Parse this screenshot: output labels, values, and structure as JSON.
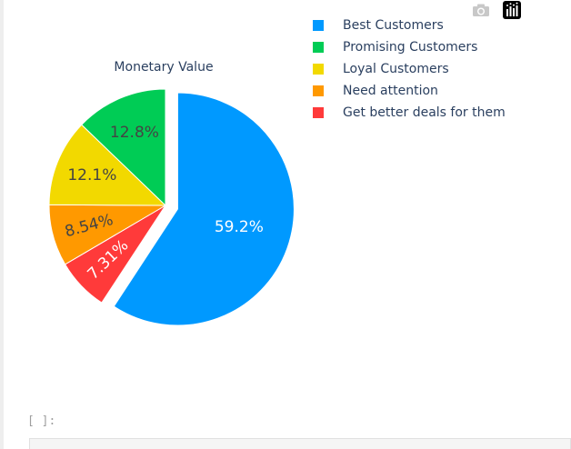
{
  "modebar": {
    "camera_icon": "camera-icon",
    "plotly_icon": "plotly-logo-icon"
  },
  "chart_data": {
    "type": "pie",
    "title": "Monetary Value",
    "start_angle_deg": 90,
    "direction": "clockwise",
    "pulled_slice": "Best Customers",
    "slices": [
      {
        "label": "Best Customers",
        "value": 59.2,
        "text": "59.2%",
        "color": "#0099ff",
        "text_color": "#ffffff"
      },
      {
        "label": "Get better deals for them",
        "value": 7.31,
        "text": "7.31%",
        "color": "#ff3a3a",
        "text_color": "#ffffff"
      },
      {
        "label": "Need attention",
        "value": 8.54,
        "text": "8.54%",
        "color": "#ff9900",
        "text_color": "#444444"
      },
      {
        "label": "Loyal Customers",
        "value": 12.1,
        "text": "12.1%",
        "color": "#f2d900",
        "text_color": "#444444"
      },
      {
        "label": "Promising Customers",
        "value": 12.8,
        "text": "12.8%",
        "color": "#00cc55",
        "text_color": "#444444"
      }
    ],
    "legend": [
      {
        "label": "Best Customers",
        "color": "#0099ff"
      },
      {
        "label": "Promising Customers",
        "color": "#00cc55"
      },
      {
        "label": "Loyal Customers",
        "color": "#f2d900"
      },
      {
        "label": "Need attention",
        "color": "#ff9900"
      },
      {
        "label": "Get better deals for them",
        "color": "#ff3a3a"
      }
    ],
    "legend_position": "top-right"
  },
  "notebook": {
    "prompt": "[ ]:"
  }
}
